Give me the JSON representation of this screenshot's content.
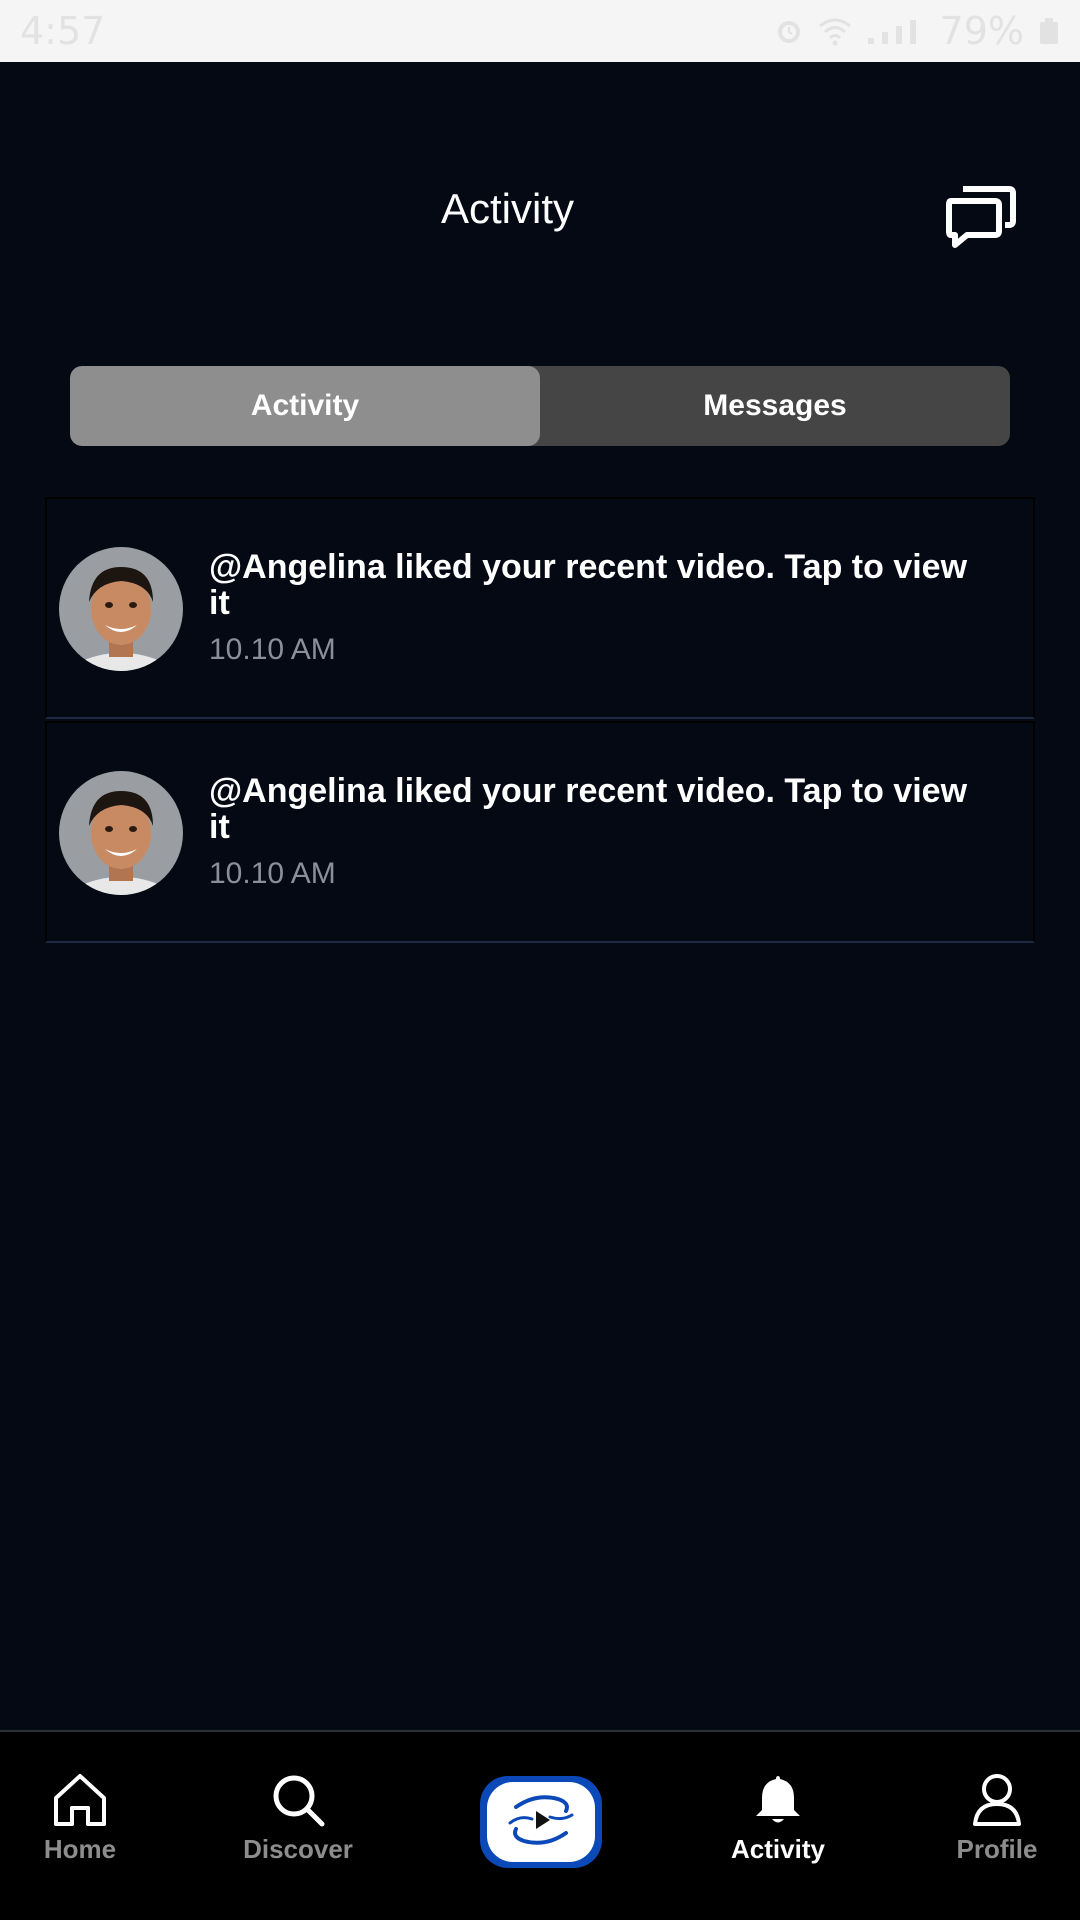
{
  "status_bar": {
    "time": "4:57",
    "battery": "79%"
  },
  "header": {
    "title": "Activity",
    "chat_icon": "chat-bubbles-icon"
  },
  "tabs": [
    {
      "label": "Activity",
      "active": true
    },
    {
      "label": "Messages",
      "active": false
    }
  ],
  "activity_items": [
    {
      "text": "@Angelina liked your recent video. Tap to view it",
      "time": "10.10 AM"
    },
    {
      "text": "@Angelina liked your recent video. Tap to view it",
      "time": "10.10 AM"
    }
  ],
  "bottom_nav": {
    "items": [
      {
        "label": "Home",
        "icon": "home-icon",
        "active": false
      },
      {
        "label": "Discover",
        "icon": "search-icon",
        "active": false
      },
      {
        "label": "Activity",
        "icon": "bell-icon",
        "active": true
      },
      {
        "label": "Profile",
        "icon": "person-icon",
        "active": false
      }
    ],
    "center_button_icon": "create-video-icon"
  },
  "colors": {
    "background": "#040914",
    "tab_active": "#8e8e8e",
    "tab_inactive": "#454545",
    "center_button": "#0b49b8"
  }
}
